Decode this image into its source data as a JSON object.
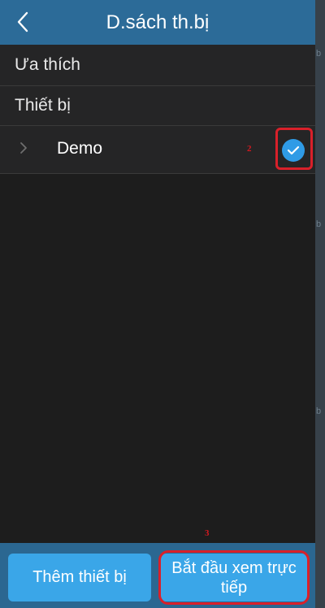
{
  "header": {
    "title": "D.sách th.bị",
    "back_icon": "chevron-left-icon"
  },
  "list": {
    "favorites_label": "Ưa thích",
    "devices_label": "Thiết bị",
    "device_item": {
      "name": "Demo",
      "selected": true,
      "expand_icon": "chevron-right-icon",
      "check_icon": "check-circle-icon"
    }
  },
  "annotations": {
    "step_2": "2",
    "step_3": "3"
  },
  "footer": {
    "add_device_label": "Thêm thiết bị",
    "start_live_label": "Bắt đầu xem trực tiếp"
  },
  "edge": {
    "chars": [
      "b",
      "b",
      "b"
    ]
  },
  "colors": {
    "header_bg": "#2c6b98",
    "button_bg": "#3aa6e8",
    "check_bg": "#2f9be6",
    "annotation_red": "#d9202a"
  }
}
